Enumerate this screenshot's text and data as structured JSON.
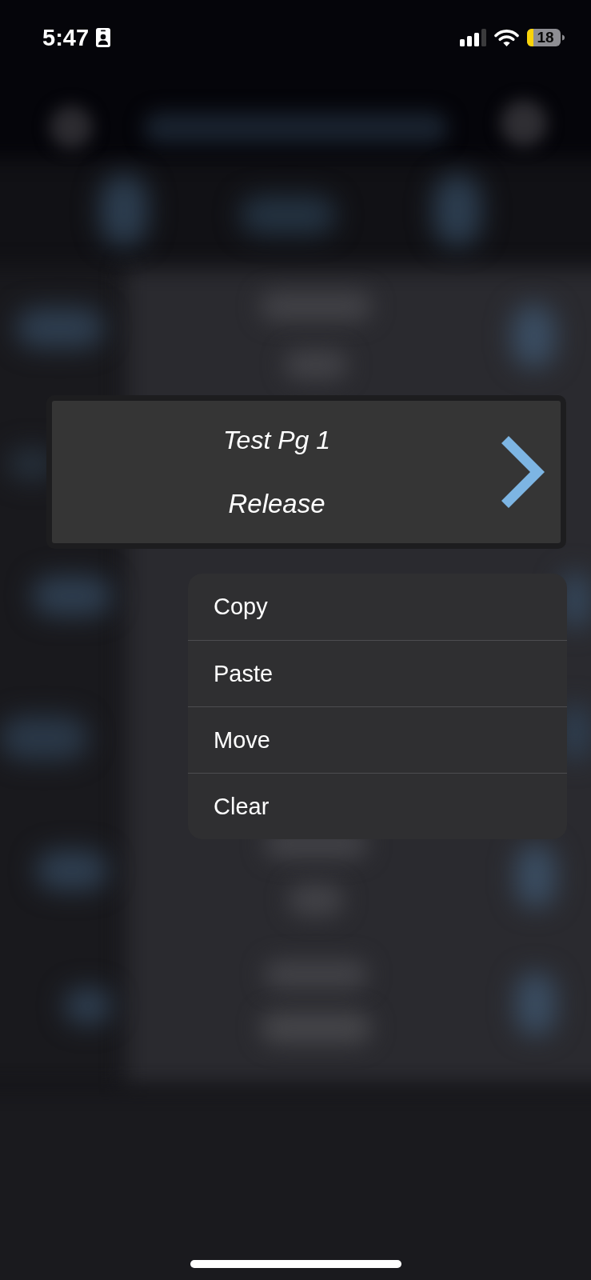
{
  "status_bar": {
    "time": "5:47",
    "battery": {
      "label": "18",
      "low_power": true
    }
  },
  "preview_card": {
    "title": "Test Pg 1",
    "subtitle": "Release"
  },
  "context_menu": {
    "items": [
      {
        "label": "Copy"
      },
      {
        "label": "Paste"
      },
      {
        "label": "Move"
      },
      {
        "label": "Clear"
      }
    ]
  }
}
